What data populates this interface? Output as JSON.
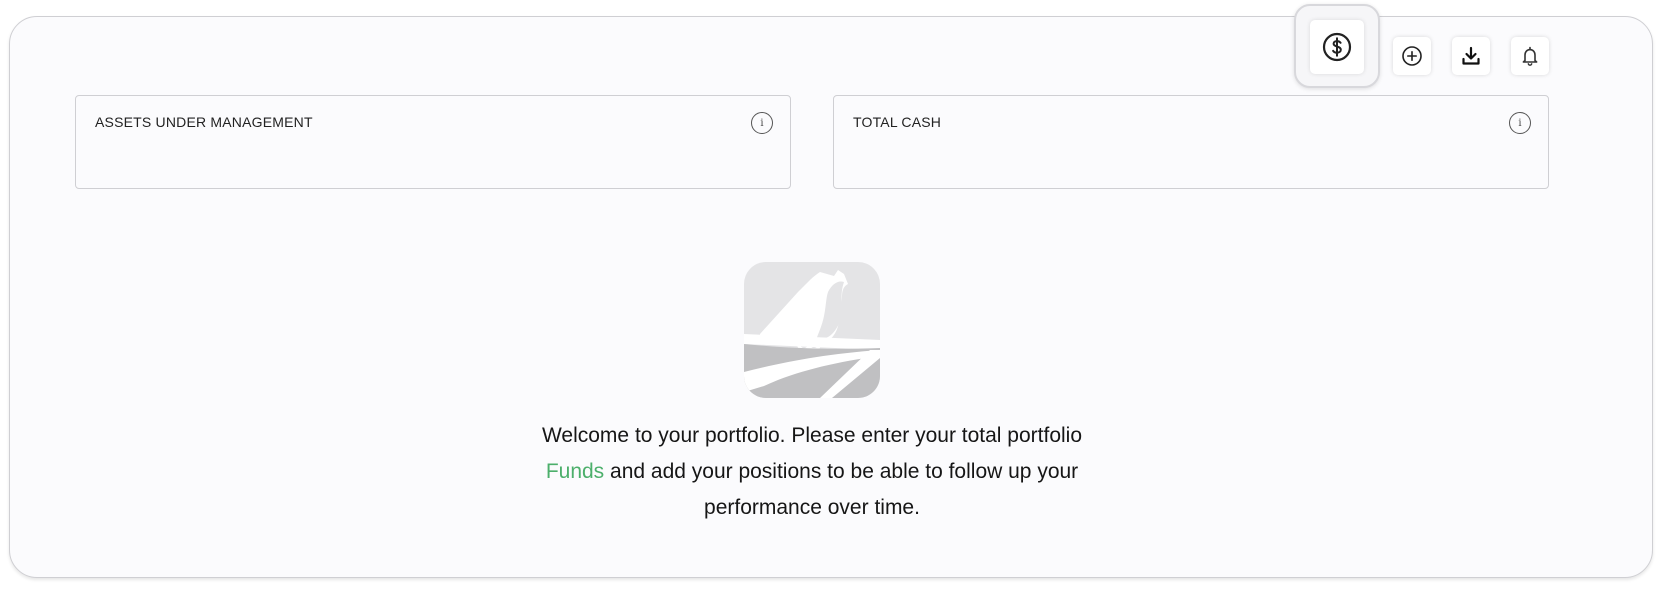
{
  "toolbar": {
    "currency_icon": "dollar-circle-icon",
    "add_icon": "plus-circle-icon",
    "download_icon": "download-icon",
    "notification_icon": "bell-icon"
  },
  "cards": {
    "aum_label": "ASSETS UNDER MANAGEMENT",
    "cash_label": "TOTAL CASH",
    "info_glyph": "i"
  },
  "empty_state": {
    "logo_icon": "bird-logo-icon",
    "text_before_link": "Welcome to your portfolio. Please enter your total portfolio ",
    "link_label": "Funds",
    "text_after_link": " and add your positions to be able to follow up your performance over time."
  },
  "colors": {
    "link": "#4caf6b",
    "logo_light": "#e4e4e6",
    "logo_dark": "#c0c0c2"
  }
}
